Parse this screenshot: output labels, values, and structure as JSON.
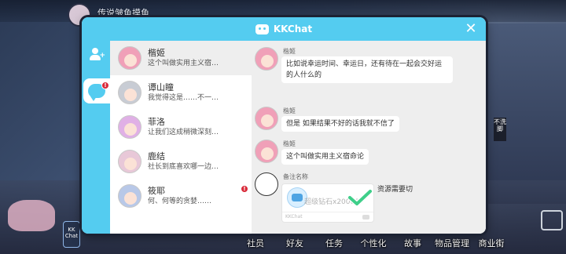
{
  "background": {
    "top_title": "传说皱鱼摸鱼",
    "side_sign": "不洗脚",
    "left_icon_label": "KK Chat",
    "nav": [
      "社员",
      "好友",
      "任务",
      "个性化",
      "故事",
      "物品管理",
      "商业街"
    ]
  },
  "dialog": {
    "title": "KKChat",
    "close_icon": "close-icon",
    "accent_color": "#54ccf0",
    "rail": {
      "contacts_icon": "add-contact-icon",
      "chat_icon": "chat-bubble-icon",
      "badge": "!"
    },
    "contacts": [
      {
        "name": "楷姬",
        "preview": "这个叫做实用主义宿…",
        "active": true,
        "color": "#f0a0b8"
      },
      {
        "name": "谭山瞳",
        "preview": "我觉得这是……不一…",
        "active": false,
        "color": "#c8ccd4"
      },
      {
        "name": "菲洛",
        "preview": "让我们这成稍微深刻…",
        "active": false,
        "color": "#e0b0e6"
      },
      {
        "name": "鹿结",
        "preview": "社长到底喜欢哪一边…",
        "active": false,
        "color": "#e8c8d8"
      },
      {
        "name": "筱耶",
        "preview": "何、何等的贪婪……",
        "active": false,
        "color": "#b8c8e8",
        "badge": "!"
      }
    ],
    "messages": [
      {
        "sender": "楷姬",
        "text": "比如说幸运时间、幸运日，还有待在一起会交好运的人什么的"
      },
      {
        "sender": "楷姬",
        "text": "但是 如果结果不好的话我就不信了"
      },
      {
        "sender": "楷姬",
        "text": "这个叫做实用主义宿命论"
      }
    ],
    "gift_message": {
      "sender": "备注名称",
      "item": "超级钻石x20000",
      "footer": "KKChat",
      "note": "资源需要切"
    }
  }
}
